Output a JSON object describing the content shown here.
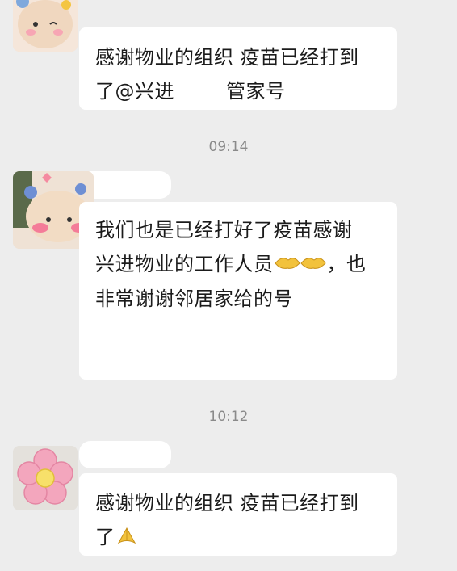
{
  "messages": [
    {
      "line1": "感谢物业的组织 疫苗已经打到",
      "line2_prefix": "了@兴进",
      "line2_suffix": "管家号",
      "avatar_icon": "bear-sticker-avatar-icon"
    },
    {
      "time": "09:14",
      "line1": "我们也是已经打好了疫苗感谢",
      "line2": "兴进物业的工作人员",
      "line2_end": "，也",
      "line3": "非常谢谢邻居家给的号",
      "emoji": "handshake-emoji",
      "avatar_icon": "pink-bear-avatar-icon"
    },
    {
      "time": "10:12",
      "line1": "感谢物业的组织 疫苗已经打到",
      "line2": "了",
      "emoji": "praying-hands-emoji",
      "avatar_icon": "pink-flower-avatar-icon"
    }
  ],
  "colors": {
    "background": "#ededed",
    "bubble": "#ffffff",
    "text": "#1b1b1b",
    "timestamp": "#8a8a8a"
  }
}
